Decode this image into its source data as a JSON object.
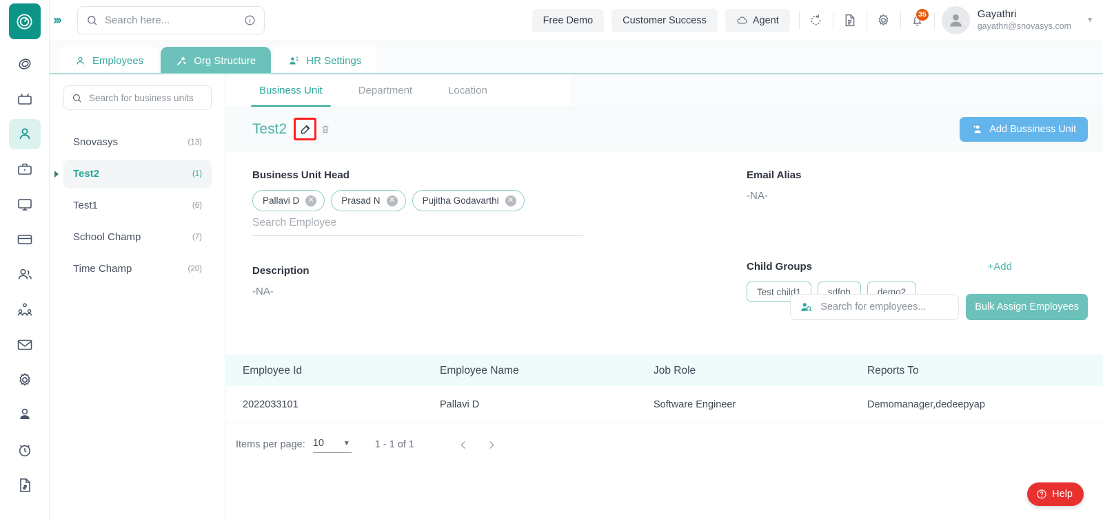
{
  "topbar": {
    "expand_icon": "chevrons-right-icon",
    "search": {
      "placeholder": "Search here...",
      "value": "",
      "icon": "search-icon",
      "info_icon": "info-icon"
    },
    "pills": [
      {
        "label": "Free Demo",
        "icon": null
      },
      {
        "label": "Customer Success",
        "icon": null
      },
      {
        "label": "Agent",
        "icon": "cloud-icon"
      }
    ],
    "icons": [
      {
        "name": "refresh-icon"
      },
      {
        "name": "document-icon"
      },
      {
        "name": "gear-icon"
      }
    ],
    "notification": {
      "icon": "bell-icon",
      "count": "35"
    },
    "profile": {
      "name": "Gayathri",
      "email": "gayathri@snovasys.com",
      "avatar_icon": "user-avatar-icon",
      "caret": "chevron-down-icon"
    }
  },
  "rail": {
    "logo_icon": "speedometer-logo-icon",
    "items": [
      {
        "icon": "spiral-icon",
        "active": false
      },
      {
        "icon": "tv-icon",
        "active": false
      },
      {
        "icon": "person-icon",
        "active": true
      },
      {
        "icon": "briefcase-icon",
        "active": false
      },
      {
        "icon": "monitor-icon",
        "active": false
      },
      {
        "icon": "card-icon",
        "active": false
      },
      {
        "icon": "people-icon",
        "active": false
      },
      {
        "icon": "group-hierarchy-icon",
        "active": false
      },
      {
        "icon": "mail-icon",
        "active": false
      },
      {
        "icon": "settings-gear-icon",
        "active": false
      },
      {
        "icon": "user-tie-icon",
        "active": false
      },
      {
        "icon": "alarm-clock-icon",
        "active": false
      },
      {
        "icon": "invoice-icon",
        "active": false
      }
    ]
  },
  "main_tabs": [
    {
      "label": "Employees",
      "icon": "person-icon",
      "active": false
    },
    {
      "label": "Org Structure",
      "icon": "tools-icon",
      "active": true
    },
    {
      "label": "HR Settings",
      "icon": "user-settings-icon",
      "active": false
    }
  ],
  "sidebar": {
    "search": {
      "placeholder": "Search for business units",
      "value": "",
      "icon": "search-icon"
    },
    "items": [
      {
        "label": "Snovasys",
        "count": "(13)",
        "selected": false
      },
      {
        "label": "Test2",
        "count": "(1)",
        "selected": true
      },
      {
        "label": "Test1",
        "count": "(6)",
        "selected": false
      },
      {
        "label": "School Champ",
        "count": "(7)",
        "selected": false
      },
      {
        "label": "Time Champ",
        "count": "(20)",
        "selected": false
      }
    ]
  },
  "sub_tabs": [
    {
      "label": "Business Unit",
      "active": true
    },
    {
      "label": "Department",
      "active": false
    },
    {
      "label": "Location",
      "active": false
    }
  ],
  "title_bar": {
    "title": "Test2",
    "edit_icon": "edit-pencil-icon",
    "delete_icon": "trash-icon",
    "add_button": {
      "label": "Add Bussiness Unit",
      "icon": "add-person-icon",
      "color": "#64b5ec"
    }
  },
  "details": {
    "business_unit_head": {
      "label": "Business Unit Head",
      "chips": [
        "Pallavi D",
        "Prasad N",
        "Pujitha Godavarthi"
      ],
      "search_placeholder": "Search Employee"
    },
    "description": {
      "label": "Description",
      "value": "-NA-"
    },
    "email_alias": {
      "label": "Email Alias",
      "value": "-NA-"
    },
    "child_groups": {
      "label": "Child Groups",
      "add_label": "+Add",
      "chips": [
        "Test child1",
        "sdfgh",
        "demo2"
      ]
    },
    "employee_search": {
      "placeholder": "Search for employees...",
      "value": "",
      "icon": "person-search-icon"
    },
    "bulk_assign_button": {
      "label": "Bulk Assign Employees",
      "color": "#6cc2bb"
    }
  },
  "table": {
    "columns": [
      "Employee Id",
      "Employee Name",
      "Job Role",
      "Reports To"
    ],
    "rows": [
      {
        "employee_id": "2022033101",
        "employee_name": "Pallavi D",
        "job_role": "Software Engineer",
        "reports_to": "Demomanager,dedeepyap"
      }
    ],
    "pagination": {
      "items_per_page_label": "Items per page:",
      "items_per_page_value": "10",
      "range": "1 - 1 of 1",
      "prev_icon": "chevron-left-icon",
      "next_icon": "chevron-right-icon"
    }
  },
  "help_button": {
    "label": "Help",
    "icon": "question-circle-icon",
    "color": "#e8302f"
  }
}
